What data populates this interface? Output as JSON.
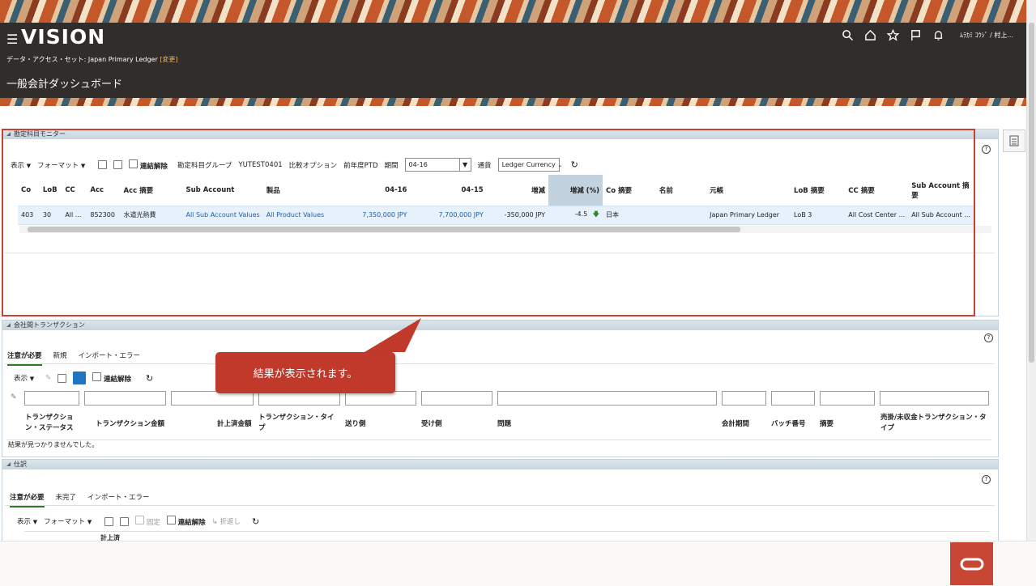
{
  "header": {
    "logo": "VISION",
    "das_label": "データ・アクセス・セット: Japan Primary Ledger",
    "das_link": "[変更]",
    "page_title": "一般会計ダッシュボード",
    "user": "ﾑﾗｶﾐ ｺｳｼﾞ / 村上...",
    "icons": [
      "search-icon",
      "home-icon",
      "star-icon",
      "flag-icon",
      "bell-icon"
    ]
  },
  "monitor": {
    "title": "勘定科目モニター",
    "toolbar": {
      "view": "表示",
      "format": "フォーマット",
      "detach": "連結解除",
      "group_label": "勘定科目グループ",
      "group_value": "YUTEST0401",
      "compare_label": "比較オプション",
      "compare_value": "前年度PTD",
      "period_label": "期間",
      "period_value": "04-16",
      "currency_label": "通貨",
      "currency_value": "Ledger Currency"
    },
    "columns": [
      "Co",
      "LoB",
      "CC",
      "Acc",
      "Acc 摘要",
      "Sub Account",
      "製品",
      "04-16",
      "04-15",
      "増減",
      "増減 (%)",
      "Co 摘要",
      "名前",
      "元帳",
      "LoB 摘要",
      "CC 摘要",
      "Sub Account 摘要"
    ],
    "row": {
      "co": "403",
      "lob": "30",
      "cc": "All ...",
      "acc": "852300",
      "acc_desc": "水道光熱費",
      "sub_account": "All Sub Account Values",
      "product": "All Product Values",
      "cur": "7,350,000 JPY",
      "prev": "7,700,000 JPY",
      "diff": "-350,000 JPY",
      "pct": "-4.5",
      "co_desc": "日本",
      "name": "",
      "ledger": "Japan Primary Ledger",
      "lob_desc": "LoB 3",
      "cc_desc": "All Cost Center ...",
      "sub_desc": "All Sub Account ..."
    }
  },
  "intercompany": {
    "title": "会社間トランザクション",
    "tabs": [
      "注意が必要",
      "新規",
      "インポート・エラー"
    ],
    "toolbar": {
      "view": "表示",
      "detach": "連結解除"
    },
    "columns": [
      "トランザクション・ステータス",
      "トランザクション金額",
      "計上済金額",
      "トランザクション・タイプ",
      "送り側",
      "受け側",
      "問題",
      "会計期間",
      "バッチ番号",
      "摘要",
      "売掛/未収金トランザクション・タイプ"
    ],
    "empty": "結果が見つかりませんでした。"
  },
  "journals": {
    "title": "仕訳",
    "tabs": [
      "注意が必要",
      "未完了",
      "インポート・エラー"
    ],
    "toolbar": {
      "view": "表示",
      "format": "フォーマット",
      "freeze": "固定",
      "detach": "連結解除",
      "wrap": "折返し"
    },
    "partial_col": "計上済"
  },
  "callout": {
    "text": "結果が表示されます。"
  }
}
